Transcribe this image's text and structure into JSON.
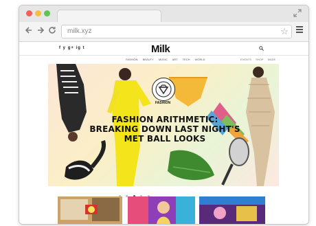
{
  "browser": {
    "url": "milk.xyz"
  },
  "site": {
    "social_icons": [
      "f",
      "y",
      "g+",
      "ig",
      "t"
    ],
    "logo": "Milk",
    "nav": [
      "FASHION",
      "BEAUTY",
      "MUSIC",
      "ART",
      "TECH",
      "WORLD"
    ],
    "subnav": [
      "EVENTS",
      "SHOP",
      "MADE"
    ],
    "hero": {
      "category": "FASHION",
      "headline": "FASHION ARITHMETIC: BREAKING DOWN LAST NIGHT'S MET BALL LOOKS"
    },
    "carousel_count": 5,
    "carousel_active": 3
  },
  "colors": {
    "close": "#f25f58",
    "minimize": "#f9be3e",
    "zoom": "#5fc453"
  },
  "icons": {
    "back": "arrow-left-icon",
    "forward": "arrow-right-icon",
    "reload": "reload-icon",
    "bookmark": "star-icon",
    "menu": "hamburger-icon",
    "search": "search-icon",
    "fullscreen": "expand-icon"
  }
}
